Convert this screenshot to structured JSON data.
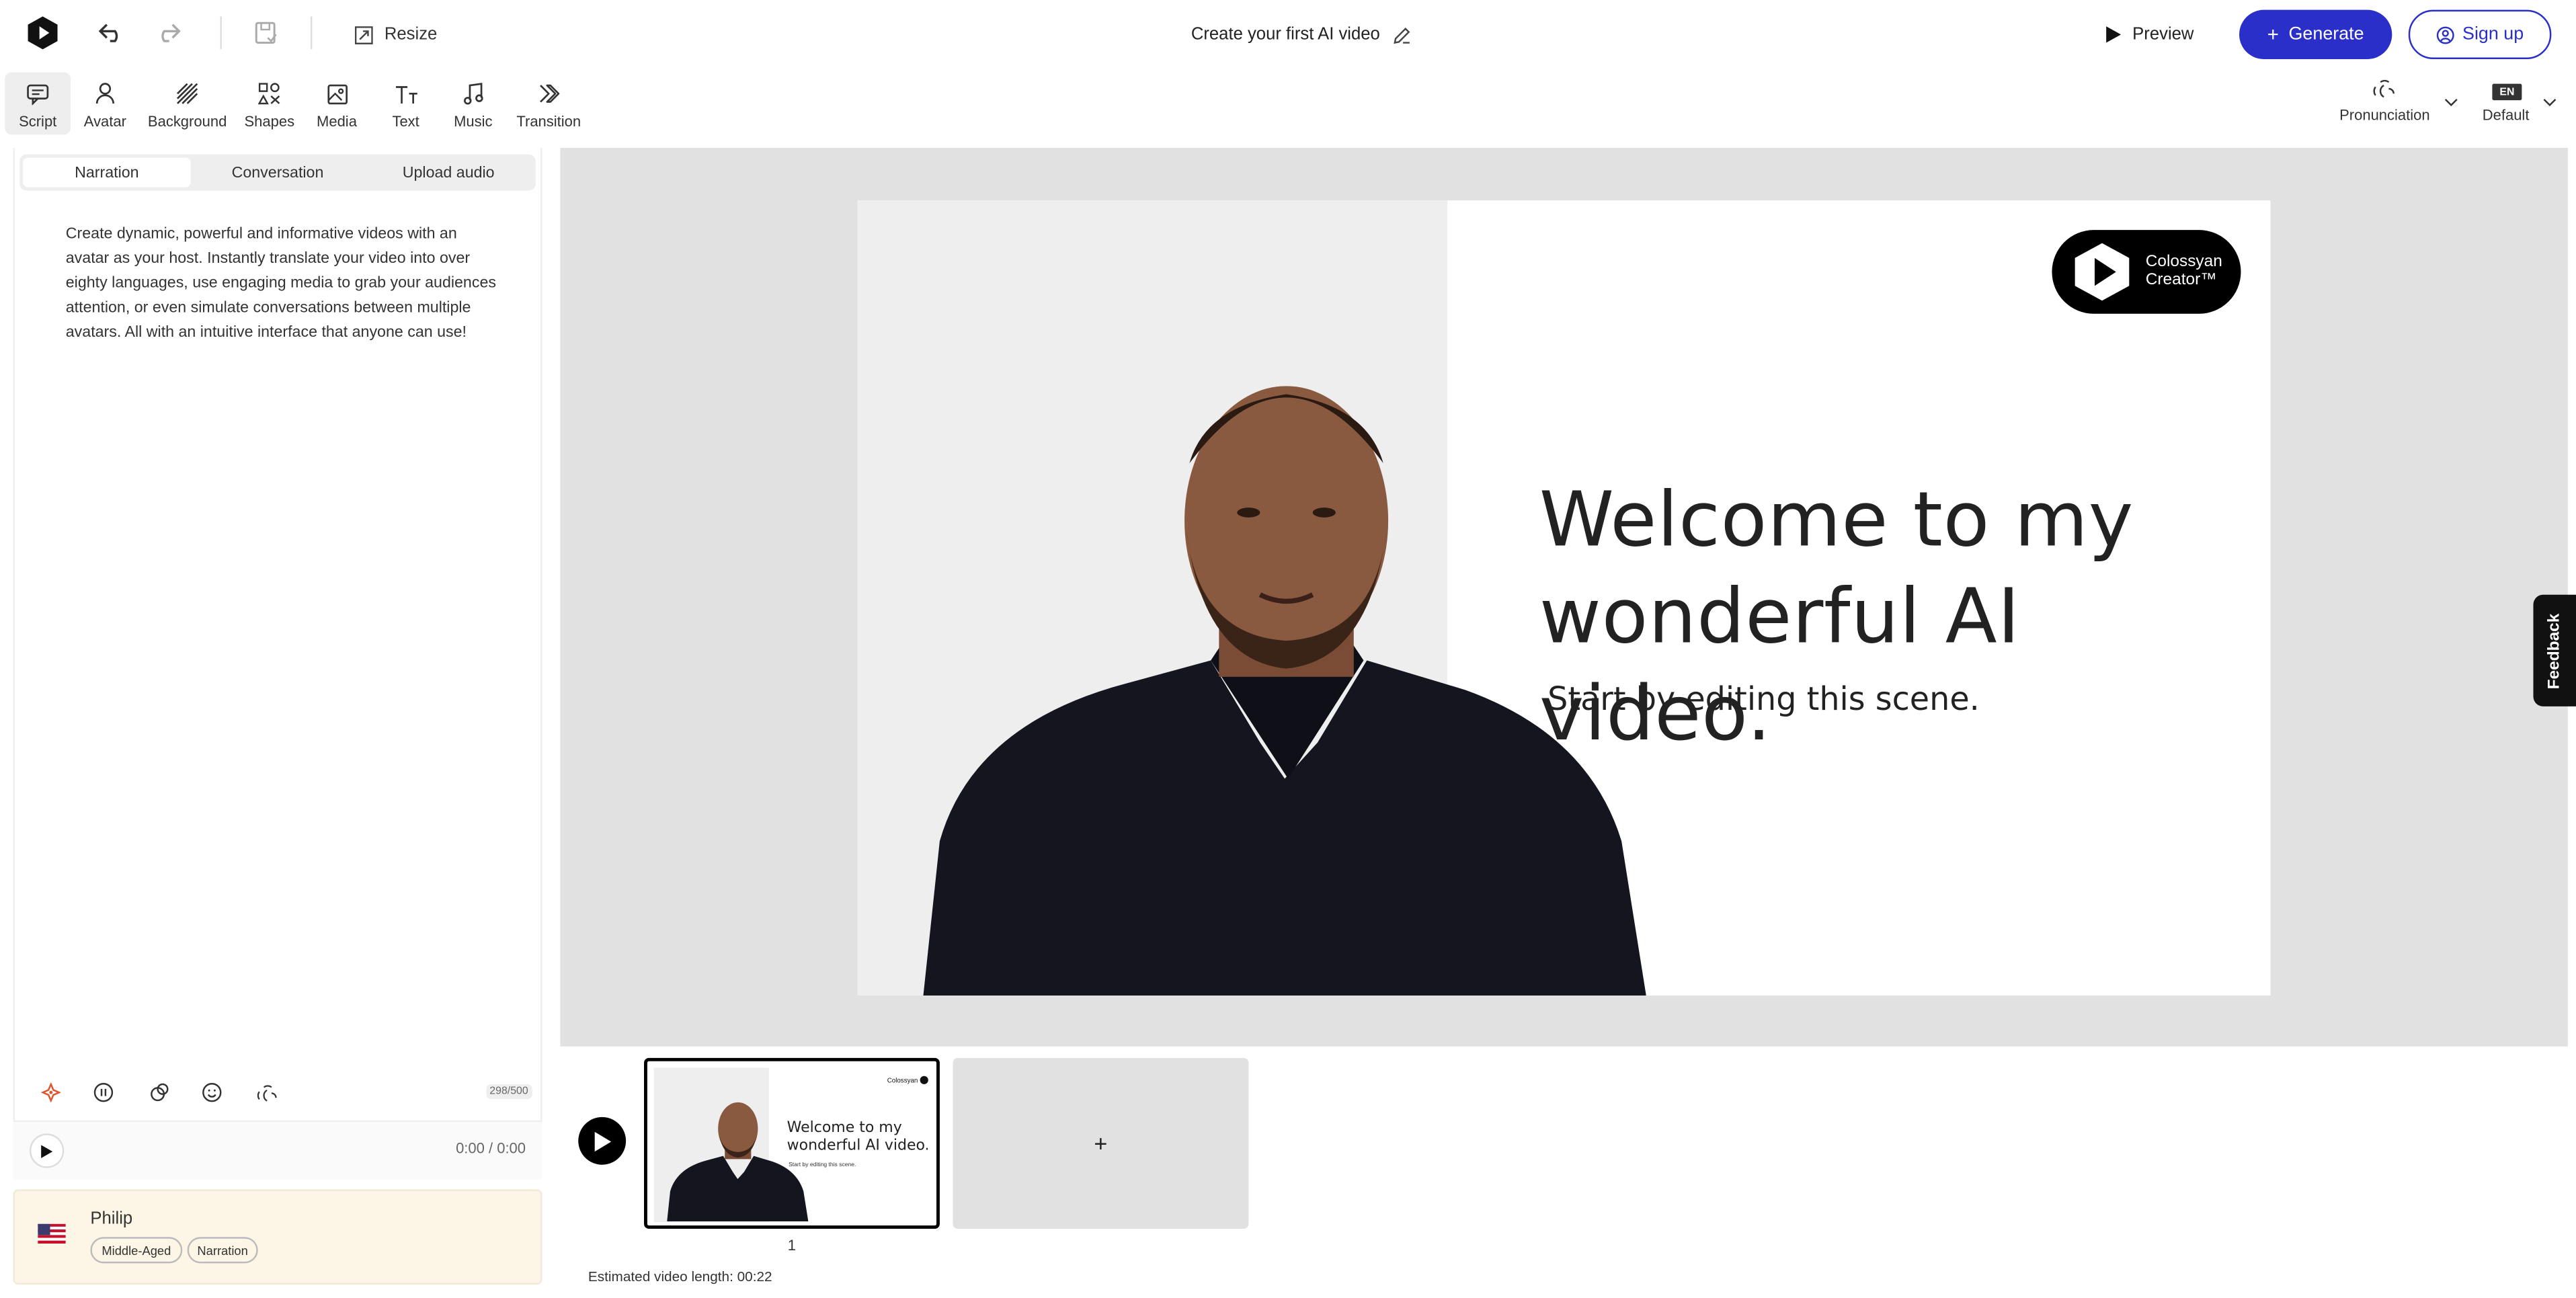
{
  "header": {
    "title": "Create your first AI video",
    "resize_label": "Resize",
    "preview_label": "Preview",
    "generate_label": "Generate",
    "signup_label": "Sign up"
  },
  "toolbar": {
    "items": [
      {
        "label": "Script",
        "icon": "script-icon",
        "active": true
      },
      {
        "label": "Avatar",
        "icon": "avatar-icon"
      },
      {
        "label": "Background",
        "icon": "background-icon"
      },
      {
        "label": "Shapes",
        "icon": "shapes-icon"
      },
      {
        "label": "Media",
        "icon": "media-icon"
      },
      {
        "label": "Text",
        "icon": "text-icon"
      },
      {
        "label": "Music",
        "icon": "music-icon"
      },
      {
        "label": "Transition",
        "icon": "transition-icon"
      }
    ],
    "pronunciation_label": "Pronunciation",
    "lang_badge": "EN",
    "lang_label": "Default"
  },
  "script_panel": {
    "tabs": [
      "Narration",
      "Conversation",
      "Upload audio"
    ],
    "active_tab": "Narration",
    "script_text": "Create dynamic, powerful and informative videos with an avatar as your host. Instantly translate your video into over eighty languages, use engaging media to grab your audiences attention, or even simulate conversations between multiple avatars. All with an intuitive interface that anyone can use!",
    "char_count": "298/500",
    "time": "0:00 / 0:00"
  },
  "avatar_card": {
    "name": "Philip",
    "tags": [
      "Middle-Aged",
      "Narration"
    ]
  },
  "slide": {
    "title_line1": "Welcome to my",
    "title_line2": "wonderful AI video.",
    "subtitle": "Start by editing this scene.",
    "logo_line1": "Colossyan",
    "logo_line2": "Creator™",
    "thumb_logo": "Colossyan"
  },
  "timeline": {
    "scene_number": "1",
    "add_label": "+",
    "estimated_length": "Estimated video length: 00:22"
  },
  "feedback_label": "Feedback",
  "colors": {
    "accent": "#2a2fc9",
    "stage_bg": "#e1e1e1",
    "avatar_card_bg": "#fdf6e7"
  }
}
